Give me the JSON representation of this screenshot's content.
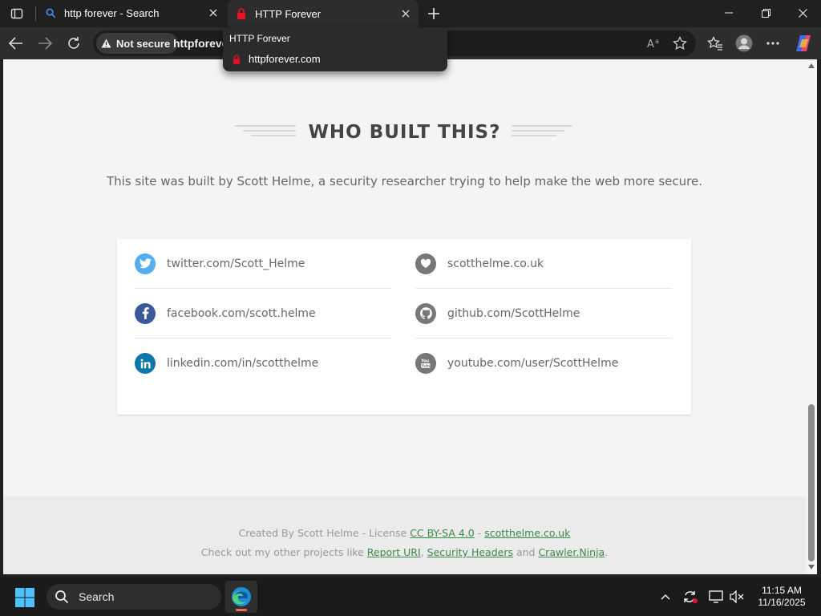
{
  "browser": {
    "tabs": [
      {
        "title": "http forever - Search",
        "icon": "search-icon"
      },
      {
        "title": "HTTP Forever",
        "icon": "red-lock-icon"
      }
    ],
    "address": {
      "security_label": "Not secure",
      "url": "httpforever.com"
    },
    "tooltip": {
      "title": "HTTP Forever",
      "url": "httpforever.com"
    }
  },
  "page": {
    "heading": "WHO BUILT THIS?",
    "intro": "This site was built by Scott Helme, a security researcher trying to help make the web more secure.",
    "links": [
      {
        "label": "twitter.com/Scott_Helme",
        "icon": "twitter-icon",
        "color": "#55acee"
      },
      {
        "label": "scotthelme.co.uk",
        "icon": "heart-icon",
        "color": "#777777"
      },
      {
        "label": "facebook.com/scott.helme",
        "icon": "facebook-icon",
        "color": "#3b5998"
      },
      {
        "label": "github.com/ScottHelme",
        "icon": "github-icon",
        "color": "#777777"
      },
      {
        "label": "linkedin.com/in/scotthelme",
        "icon": "linkedin-icon",
        "color": "#0e76a8"
      },
      {
        "label": "youtube.com/user/ScottHelme",
        "icon": "youtube-icon",
        "color": "#777777"
      }
    ],
    "footer": {
      "line1_prefix": "Created By Scott Helme - License ",
      "license": "CC BY-SA 4.0",
      "line1_sep": " - ",
      "site": "scotthelme.co.uk",
      "line2_prefix": "Check out my other projects like ",
      "project1": "Report URI",
      "sep1": ", ",
      "project2": "Security Headers",
      "sep2": " and ",
      "project3": "Crawler.Ninja",
      "line2_suffix": "."
    }
  },
  "taskbar": {
    "search_placeholder": "Search",
    "time": "11:15 AM",
    "date": "11/16/2025"
  }
}
